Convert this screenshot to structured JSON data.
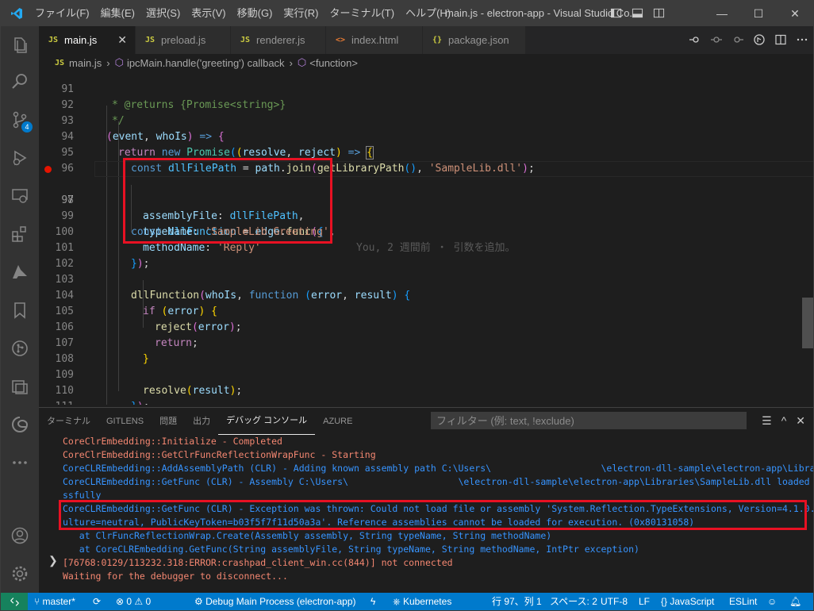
{
  "window": {
    "title": "main.js - electron-app - Visual Studio Co...",
    "menu": [
      "ファイル(F)",
      "編集(E)",
      "選択(S)",
      "表示(V)",
      "移動(G)",
      "実行(R)",
      "ターミナル(T)",
      "ヘルプ(H)"
    ],
    "controls": {
      "minimize": "—",
      "maximize": "☐",
      "close": "✕"
    }
  },
  "activity_bar": {
    "items": [
      "explorer-icon",
      "search-icon",
      "source-control-icon",
      "run-debug-icon",
      "remote-explorer-icon",
      "extensions-icon",
      "azure-icon",
      "bookmarks-icon",
      "git-graph-icon",
      "docker-icon",
      "edge-tools-icon",
      "more-icon",
      "accounts-icon",
      "manage-icon"
    ],
    "scm_badge": "4"
  },
  "tabs": [
    {
      "icon": "JS",
      "label": "main.js",
      "active": true,
      "close": "✕"
    },
    {
      "icon": "JS",
      "label": "preload.js"
    },
    {
      "icon": "JS",
      "label": "renderer.js"
    },
    {
      "icon": "<>",
      "label": "index.html"
    },
    {
      "icon": "{}",
      "label": "package.json"
    }
  ],
  "breadcrumb": {
    "file_icon": "JS",
    "file": "main.js",
    "symbol1": "ipcMain.handle('greeting') callback",
    "symbol2": "<function>"
  },
  "editor": {
    "line_numbers": [
      "91",
      "92",
      "93",
      "94",
      "95",
      "96",
      "97",
      "98",
      "99",
      "100",
      "101",
      "102",
      "103",
      "104",
      "105",
      "106",
      "107",
      "108",
      "109",
      "110",
      "111"
    ],
    "blame": "You, 2 週間前 ・ 引数を追加。",
    "current_line": "97",
    "breakpoint_line": "97",
    "code": {
      "l91": "* @returns {Promise<string>}",
      "l92": "*/",
      "l93_param1": "event",
      "l93_param2": "whoIs",
      "l94_kw": "return",
      "l94_new": "new",
      "l94_cls": "Promise",
      "l94_p1": "resolve",
      "l94_p2": "reject",
      "l95_const": "const",
      "l95_var": "dllFilePath",
      "l95_obj": "path",
      "l95_fn": "join",
      "l95_fn2": "getLibraryPath",
      "l95_str": "'SampleLib.dll'",
      "l97_const": "const",
      "l97_var": "dllFunction",
      "l97_obj": "edge",
      "l97_fn": "func",
      "l98_key": "assemblyFile",
      "l98_val": "dllFilePath",
      "l99_key": "typeName",
      "l99_val": "'SampleLib.Greeting'",
      "l100_key": "methodName",
      "l100_val": "'Reply'",
      "l103_fn": "dllFunction",
      "l103_arg": "whoIs",
      "l103_kw": "function",
      "l103_p1": "error",
      "l103_p2": "result",
      "l104_kw": "if",
      "l104_var": "error",
      "l105_fn": "reject",
      "l105_arg": "error",
      "l106_kw": "return",
      "l109_fn": "resolve",
      "l109_arg": "result"
    }
  },
  "panel": {
    "tabs": [
      "ターミナル",
      "GITLENS",
      "問題",
      "出力",
      "デバッグ コンソール",
      "AZURE"
    ],
    "active_tab": "デバッグ コンソール",
    "filter_placeholder": "フィルター (例: text, !exclude)",
    "console_lines": [
      {
        "text": "CoreClrEmbedding::Initialize - Completed",
        "color": "#f48771"
      },
      {
        "text": "CoreClrEmbedding::GetClrFuncReflectionWrapFunc - Starting",
        "color": "#f48771"
      },
      {
        "text": "CoreCLREmbedding::AddAssemblyPath (CLR) - Adding known assembly path C:\\Users\\                    \\electron-dll-sample\\electron-app\\Libraries",
        "color": "#3794ff"
      },
      {
        "text": "CoreCLREmbedding::GetFunc (CLR) - Assembly C:\\Users\\                    \\electron-dll-sample\\electron-app\\Libraries\\SampleLib.dll loaded succe",
        "color": "#3794ff"
      },
      {
        "text": "ssfully",
        "color": "#3794ff"
      },
      {
        "text": "CoreCLREmbedding::GetFunc (CLR) - Exception was thrown: Could not load file or assembly 'System.Reflection.TypeExtensions, Version=4.1.0.0, C",
        "color": "#3794ff"
      },
      {
        "text": "ulture=neutral, PublicKeyToken=b03f5f7f11d50a3a'. Reference assemblies cannot be loaded for execution. (0x80131058)",
        "color": "#3794ff"
      },
      {
        "text": "   at ClrFuncReflectionWrap.Create(Assembly assembly, String typeName, String methodName)",
        "color": "#3794ff"
      },
      {
        "text": "   at CoreCLREmbedding.GetFunc(String assemblyFile, String typeName, String methodName, IntPtr exception)",
        "color": "#3794ff"
      },
      {
        "text": "[76768:0129/113232.318:ERROR:crashpad_client_win.cc(844)] not connected",
        "color": "#f48771"
      },
      {
        "text": "Waiting for the debugger to disconnect...",
        "color": "#f48771"
      }
    ],
    "prompt": "❯"
  },
  "status_bar": {
    "remote_icon": "remote-icon",
    "branch": "master*",
    "sync_icon": "sync-icon",
    "problems": "⊗ 0 ⚠ 0",
    "debug": "Debug Main Process (electron-app)",
    "kubernetes": "Kubernetes",
    "position": "行 97、列 1",
    "spaces": "スペース: 2",
    "encoding": "UTF-8",
    "eol": "LF",
    "language": "JavaScript",
    "lint": "ESLint",
    "bell_icon": "bell-icon"
  }
}
